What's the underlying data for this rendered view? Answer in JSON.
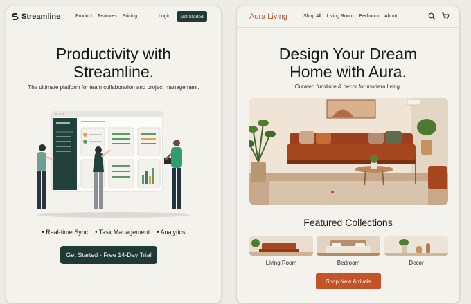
{
  "left": {
    "brand": "Streamline",
    "nav": [
      "Product",
      "Features",
      "Pricing"
    ],
    "login": "Login",
    "nav_cta": "Get Started",
    "hero_title_line1": "Productivity with",
    "hero_title_line2": "Streamline.",
    "hero_sub": "The ultimate platform for team collaboration and project management.",
    "features": [
      "Real-time Sync",
      "Task Management",
      "Analytics"
    ],
    "cta": "Get Started - Free 14-Day Trial"
  },
  "right": {
    "brand": "Aura Living",
    "nav": [
      "Shop All",
      "Living Room",
      "Bedroom",
      "About"
    ],
    "hero_title_line1": "Design Your Dream",
    "hero_title_line2": "Home with Aura.",
    "hero_sub": "Curated furniture & decor for modern living.",
    "featured_title": "Featured Collections",
    "collections": [
      "Living Room",
      "Bedroom",
      "Decor"
    ],
    "cta": "Shop New Arrivals"
  },
  "colors": {
    "dark_green": "#1f3a34",
    "terracotta": "#c4532a",
    "background": "#f3f2ed"
  },
  "icons": [
    "logo-s-icon",
    "search-icon",
    "cart-icon"
  ]
}
